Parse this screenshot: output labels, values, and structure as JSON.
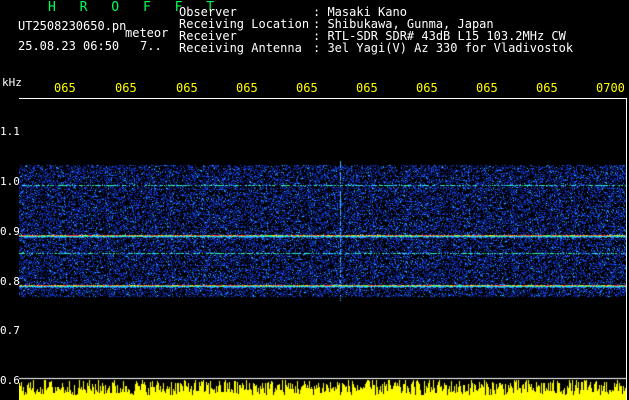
{
  "title": "H R O F F T",
  "file_name": "UT2508230650.pn",
  "meteor_label": "meteor",
  "datetime": "25.08.23 06:50",
  "count": "7..",
  "fields": [
    {
      "label": "Observer",
      "value": ": Masaki Kano"
    },
    {
      "label": "Receiving Location",
      "value": ": Shibukawa, Gunma, Japan"
    },
    {
      "label": "Receiver",
      "value": ": RTL-SDR SDR# 43dB L15 103.2MHz CW"
    },
    {
      "label": "Receiving Antenna",
      "value": ": 3el Yagi(V) Az 330 for Vladivostok"
    }
  ],
  "y_unit": "kHz",
  "time_ticks": [
    "065",
    "065",
    "065",
    "065",
    "065",
    "065",
    "065",
    "065",
    "065",
    "0700"
  ],
  "freq_ticks": [
    "1.1",
    "1.0",
    "0.9",
    "0.8",
    "0.7",
    "0.6"
  ],
  "colors": {
    "title_green": "#00ff55",
    "tick_yellow": "#ffff00",
    "noise_blue": "#1a3dff",
    "signal_red": "#ff2020",
    "signal_green": "#30ff80"
  },
  "chart_data": {
    "type": "heatmap",
    "title": "H R O F F T",
    "ylabel": "kHz",
    "x_ticks": [
      "065",
      "065",
      "065",
      "065",
      "065",
      "065",
      "065",
      "065",
      "065",
      "0700"
    ],
    "y_ticks": [
      1.1,
      1.0,
      0.9,
      0.8,
      0.7,
      0.6
    ],
    "ylim": [
      0.6,
      1.15
    ],
    "noise_band_khz": [
      0.77,
      1.03
    ],
    "strong_lines_khz": [
      0.79,
      0.89
    ],
    "weak_lines_khz": [
      0.855,
      0.99
    ],
    "grid": false
  }
}
